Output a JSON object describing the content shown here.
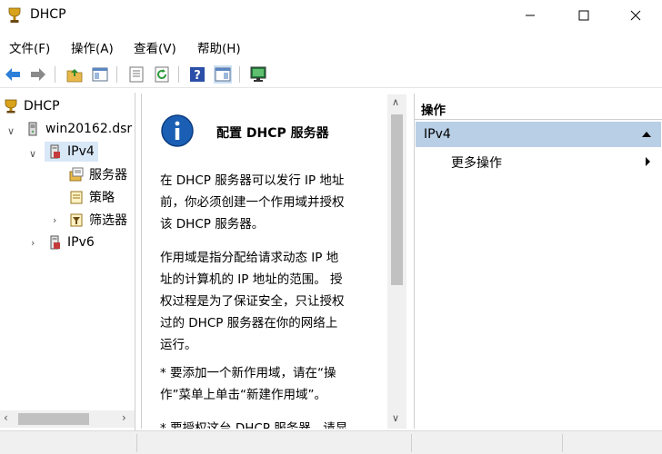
{
  "window": {
    "title": "DHCP"
  },
  "menu": [
    "文件(F)",
    "操作(A)",
    "查看(V)",
    "帮助(H)"
  ],
  "toolbar": {
    "buttons": [
      "back-arrow-icon",
      "forward-arrow-icon",
      "up-folder-icon",
      "show-hide-tree-icon",
      "properties-icon",
      "refresh-icon",
      "help-icon",
      "show-action-pane-icon",
      "monitor-icon"
    ]
  },
  "tree": {
    "root": "DHCP",
    "server": "win20162.dsr",
    "ipv4": "IPv4",
    "server_options": "服务器",
    "policies": "策略",
    "filters": "筛选器",
    "ipv6": "IPv6"
  },
  "content": {
    "heading": "配置 DHCP 服务器",
    "para1": [
      "在 DHCP 服务器可以发行 IP 地址",
      "前，你必须创建一个作用域并授权",
      "该 DHCP 服务器。"
    ],
    "para2": [
      "作用域是指分配给请求动态 IP 地",
      "址的计算机的 IP 地址的范围。 授",
      "权过程是为了保证安全，只让授权",
      "过的 DHCP 服务器在你的网络上",
      "运行。"
    ],
    "para3": [
      "* 要添加一个新作用域，请在“操",
      "作”菜单上单击“新建作用域”。"
    ],
    "para4_partial": "* 要授权这台 DHCP 服务器，请显"
  },
  "actions": {
    "header": "操作",
    "section": "IPv4",
    "more": "更多操作"
  },
  "colors": {
    "selection": "#d9e8f7",
    "action_section_bg": "#b8cfe6",
    "info_icon": "#1a5fb4"
  }
}
